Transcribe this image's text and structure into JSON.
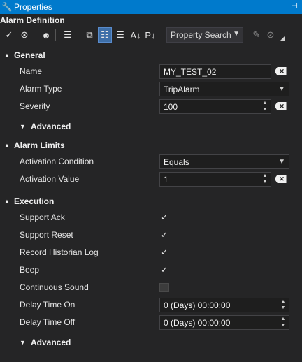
{
  "window": {
    "title": "Properties",
    "pin_icon": "pin-icon"
  },
  "header": {
    "title": "Alarm Definition"
  },
  "toolbar": {
    "search_label": "Property Search",
    "icons": [
      "checkmark-icon",
      "cancel-circle-icon",
      "smiley-icon",
      "list-icon",
      "copy-icon",
      "categorized-icon",
      "alphabetical-list-icon",
      "sort-az-icon",
      "property-icon",
      "pin-icon",
      "clear-icon"
    ]
  },
  "sections": {
    "general": "General",
    "alarm_limits": "Alarm Limits",
    "execution": "Execution",
    "advanced": "Advanced"
  },
  "properties": {
    "name": {
      "label": "Name",
      "value": "MY_TEST_02"
    },
    "alarm_type": {
      "label": "Alarm Type",
      "value": "TripAlarm"
    },
    "severity": {
      "label": "Severity",
      "value": "100"
    },
    "activation_condition": {
      "label": "Activation Condition",
      "value": "Equals"
    },
    "activation_value": {
      "label": "Activation Value",
      "value": "1"
    },
    "support_ack": {
      "label": "Support Ack",
      "checked": true
    },
    "support_reset": {
      "label": "Support Reset",
      "checked": true
    },
    "record_historian_log": {
      "label": "Record Historian Log",
      "checked": true
    },
    "beep": {
      "label": "Beep",
      "checked": true
    },
    "continuous_sound": {
      "label": "Continuous Sound",
      "checked": false
    },
    "delay_time_on": {
      "label": "Delay Time On",
      "value": "0 (Days) 00:00:00"
    },
    "delay_time_off": {
      "label": "Delay Time Off",
      "value": "0 (Days) 00:00:00"
    }
  },
  "colors": {
    "accent": "#007acc",
    "background": "#252526",
    "field": "#1e1e1e",
    "active_button": "#3e6fa8"
  }
}
